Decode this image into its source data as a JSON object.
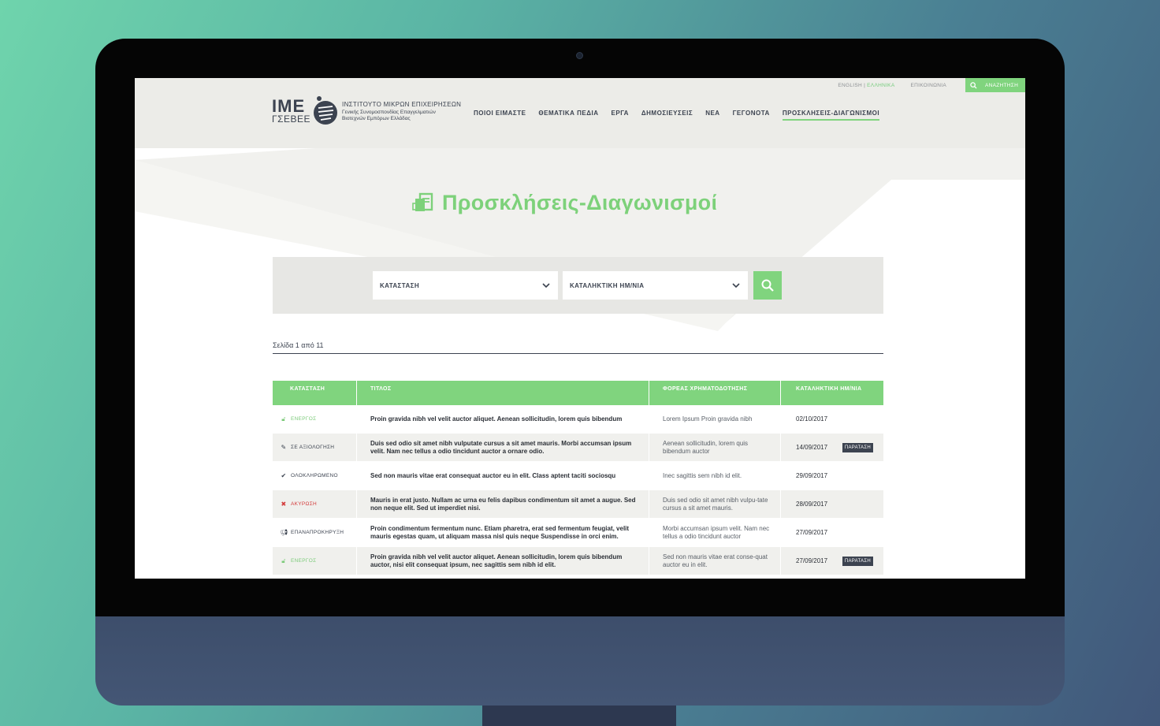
{
  "topbar": {
    "lang_en": "ENGLISH",
    "lang_sep": " | ",
    "lang_el": "ΕΛΛΗΝΙΚΑ",
    "contact": "ΕΠΙΚΟΙΝΩΝΙΑ",
    "search": "ΑΝΑΖΗΤΗΣΗ"
  },
  "logo": {
    "ime": "IME",
    "gsevee": "ΓΣΕΒΕΕ",
    "line1": "ΙΝΣΤΙΤΟΥΤΟ ΜΙΚΡΩΝ ΕΠΙΧΕΙΡΗΣΕΩΝ",
    "line2": "Γενικής Συνομοσπονδίας Επαγγελματιών",
    "line3": "Βιοτεχνών Εμπόρων Ελλάδας"
  },
  "nav": [
    {
      "label": "ΠΟΙΟΙ ΕΙΜΑΣΤΕ"
    },
    {
      "label": "ΘΕΜΑΤΙΚΑ ΠΕΔΙΑ"
    },
    {
      "label": "ΕΡΓΑ"
    },
    {
      "label": "ΔΗΜΟΣΙΕΥΣΕΙΣ"
    },
    {
      "label": "ΝΕΑ"
    },
    {
      "label": "ΓΕΓΟΝΟΤΑ"
    },
    {
      "label": "ΠΡΟΣΚΛΗΣΕΙΣ-ΔΙΑΓΩΝΙΣΜΟΙ"
    }
  ],
  "page_title": "Προσκλήσεις-Διαγωνισμοί",
  "filters": {
    "status": "ΚΑΤΑΣΤΑΣΗ",
    "deadline": "ΚΑΤΑΛΗΚΤΙΚΗ ΗΜ/ΝΙΑ"
  },
  "page_info": "Σελίδα 1 από 11",
  "table": {
    "headers": {
      "status": "ΚΑΤΑΣΤΑΣΗ",
      "title": "ΤΙΤΛΟΣ",
      "funder": "ΦΟΡΕΑΣ ΧΡΗΜΑΤΟΔΟΤΗΣΗΣ",
      "deadline": "ΚΑΤΑΛΗΚΤΙΚΗ ΗΜ/ΝΙΑ"
    },
    "rows": [
      {
        "status": "ΕΝΕΡΓΟΣ",
        "icon": "unlock-icon",
        "title": "Proin gravida nibh vel velit auctor aliquet. Aenean sollicitudin, lorem quis bibendum",
        "funder": "Lorem Ipsum Proin gravida nibh",
        "date": "02/10/2017",
        "badge": ""
      },
      {
        "status": "ΣΕ ΑΞΙΟΛΟΓΗΣΗ",
        "icon": "pencil-icon",
        "title": "Duis sed odio sit amet nibh vulputate cursus a sit amet mauris. Morbi accumsan ipsum velit. Nam nec tellus a odio tincidunt auctor a ornare odio.",
        "funder": "Aenean sollicitudin, lorem quis bibendum auctor",
        "date": "14/09/2017",
        "badge": "ΠΑΡΑΤΑΣΗ"
      },
      {
        "status": "ΟΛΟΚΛΗΡΩΜΕΝΟ",
        "icon": "check-icon",
        "title": "Sed non  mauris vitae erat consequat auctor eu in elit. Class aptent taciti sociosqu",
        "funder": "Inec sagittis sem nibh id elit.",
        "date": "29/09/2017",
        "badge": ""
      },
      {
        "status": "ΑΚΥΡΩΣΗ",
        "icon": "cross-icon",
        "title": "Mauris in erat justo. Nullam ac urna eu felis dapibus condimentum sit amet a augue. Sed non neque elit. Sed ut imperdiet nisi.",
        "funder": "Duis sed odio sit amet nibh vulpu-tate cursus a sit amet mauris.",
        "date": "28/09/2017",
        "badge": ""
      },
      {
        "status": "ΕΠΑΝΑΠΡΟΚΗΡΥΞΗ",
        "icon": "megaphone-icon",
        "title": "Proin condimentum fermentum nunc. Etiam pharetra, erat sed fermentum feugiat, velit mauris egestas quam, ut aliquam massa nisl quis neque Suspendisse in orci enim.",
        "funder": "Morbi accumsan ipsum velit. Nam nec tellus a odio tincidunt auctor",
        "date": "27/09/2017",
        "badge": ""
      },
      {
        "status": "ΕΝΕΡΓΟΣ",
        "icon": "unlock-icon",
        "title": "Proin gravida nibh vel velit auctor aliquet. Aenean sollicitudin, lorem quis bibendum auctor, nisi elit consequat ipsum, nec sagittis sem nibh id elit.",
        "funder": "Sed non  mauris vitae erat conse-quat auctor eu in elit.",
        "date": "27/09/2017",
        "badge": "ΠΑΡΑΤΑΣΗ"
      }
    ]
  },
  "colors": {
    "accent": "#80d47e",
    "dark": "#3c4350",
    "danger": "#d33a3a"
  }
}
